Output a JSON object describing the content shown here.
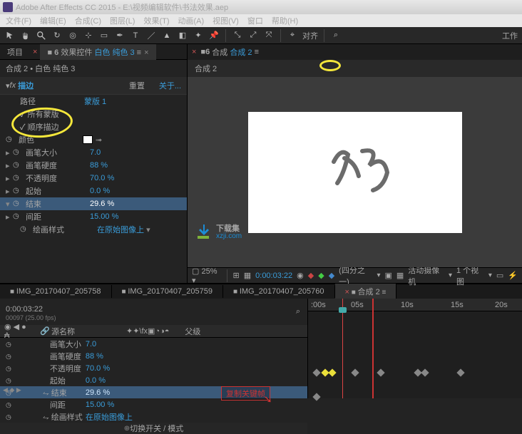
{
  "title": "Adobe After Effects CC 2015 - E:\\视频编辑软件\\书法效果.aep",
  "menu": [
    "文件(F)",
    "编辑(E)",
    "合成(C)",
    "图层(L)",
    "效果(T)",
    "动画(A)",
    "视图(V)",
    "窗口",
    "帮助(H)"
  ],
  "toolbar_right": {
    "snap": "对齐",
    "work": "工作"
  },
  "tabs": {
    "project": "项目",
    "effect_controls": "效果控件",
    "ec_target": "白色 纯色 3"
  },
  "crumb": "合成 2 • 白色 纯色 3",
  "fx": {
    "name": "描边",
    "reset": "重置",
    "about": "关于..."
  },
  "props": {
    "path_label": "路径",
    "mask1": "蒙版 1",
    "all_masks": "所有蒙版",
    "sequential": "顺序描边",
    "color": "颜色",
    "brush_size": {
      "n": "画笔大小",
      "v": "7.0"
    },
    "brush_hard": {
      "n": "画笔硬度",
      "v": "88 %"
    },
    "opacity": {
      "n": "不透明度",
      "v": "70.0 %"
    },
    "start": {
      "n": "起始",
      "v": "0.0 %"
    },
    "end": {
      "n": "结束",
      "v": "29.6 %"
    },
    "spacing": {
      "n": "间距",
      "v": "15.00 %"
    },
    "paint_style": {
      "n": "绘画样式",
      "v": "在原始图像上"
    }
  },
  "comp_tab": {
    "num": "6",
    "name": "合成",
    "item": "合成 2"
  },
  "comp_crumb": "合成 2",
  "watermark": {
    "title": "下载集",
    "url": "xzji.com"
  },
  "viewer_bar": {
    "zoom": "25%",
    "time": "0:00:03:22",
    "res": "(四分之一)",
    "camera": "活动摄像机",
    "views": "1 个视图"
  },
  "tl_tabs": [
    "IMG_20170407_205758",
    "IMG_20170407_205759",
    "IMG_20170407_205760",
    "合成 2"
  ],
  "tl_time": "0:00:03:22",
  "tl_time_sub": "00097 (25.00 fps)",
  "tl_cols": {
    "src": "源名称",
    "parent": "父级"
  },
  "tl_props": {
    "brush_size": {
      "n": "画笔大小",
      "v": "7.0"
    },
    "brush_hard": {
      "n": "画笔硬度",
      "v": "88 %"
    },
    "opacity": {
      "n": "不透明度",
      "v": "70.0 %"
    },
    "start": {
      "n": "起始",
      "v": "0.0 %"
    },
    "end": {
      "n": "结束",
      "v": "29.6 %"
    },
    "spacing": {
      "n": "间距",
      "v": "15.00 %"
    },
    "paint_style": {
      "n": "绘画样式",
      "v": "在原始图像上"
    }
  },
  "ruler": {
    "t0": ":00s",
    "t1": "05s",
    "t2": "10s",
    "t3": "15s",
    "t4": "20s"
  },
  "anno": "复制关键帧",
  "footer": "切换开关 / 模式"
}
